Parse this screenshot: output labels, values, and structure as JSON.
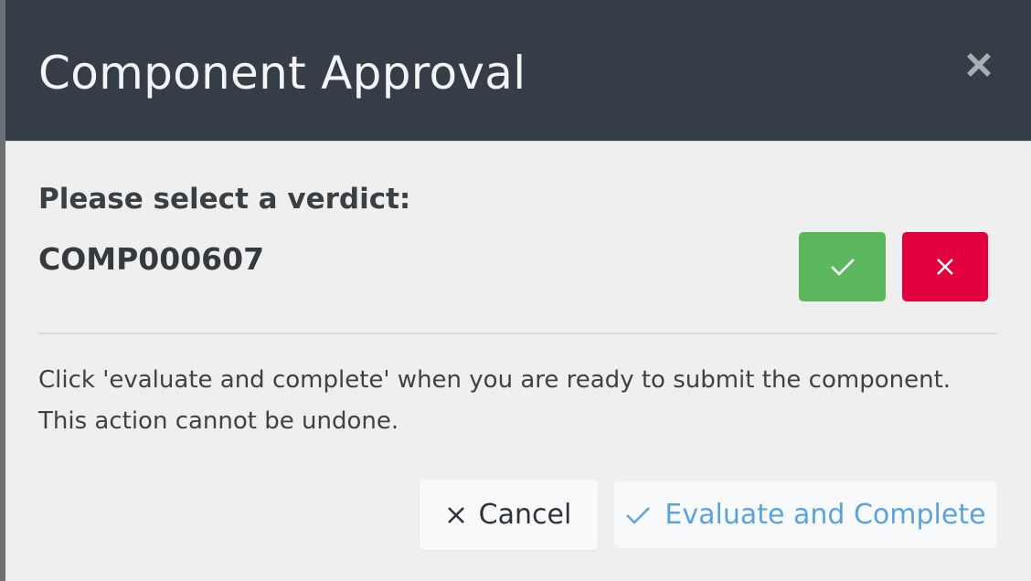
{
  "dialog": {
    "title": "Component Approval",
    "close_icon": "close-icon"
  },
  "verdict": {
    "prompt": "Please select a verdict:",
    "component_code": "COMP000607",
    "approve_icon": "checkmark-icon",
    "reject_icon": "x-icon",
    "approve_color": "#5cb85c",
    "reject_color": "#e2003f"
  },
  "note": "Click 'evaluate and complete' when you are ready to submit the component. This action cannot be undone.",
  "footer": {
    "cancel_label": "Cancel",
    "cancel_icon": "x-icon",
    "evaluate_label": "Evaluate and Complete",
    "evaluate_icon": "checkmark-icon",
    "evaluate_color": "#5ba3dc"
  },
  "colors": {
    "header_bg": "#353d47",
    "modal_bg": "#efefef"
  }
}
